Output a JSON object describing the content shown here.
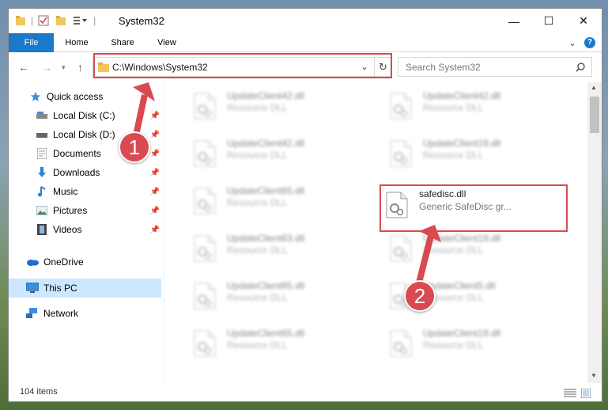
{
  "window": {
    "title": "System32",
    "controls": {
      "minimize": "—",
      "maximize": "☐",
      "close": "✕"
    }
  },
  "ribbon": {
    "tabs": [
      "File",
      "Home",
      "Share",
      "View"
    ],
    "help": "?"
  },
  "nav": {
    "address": "C:\\Windows\\System32",
    "search_placeholder": "Search System32"
  },
  "sidebar": {
    "items": [
      {
        "label": "Quick access",
        "icon": "star-icon",
        "pinned": false
      },
      {
        "label": "Local Disk (C:)",
        "icon": "drive-icon",
        "pinned": true
      },
      {
        "label": "Local Disk (D:)",
        "icon": "drive-icon",
        "pinned": true
      },
      {
        "label": "Documents",
        "icon": "documents-icon",
        "pinned": true
      },
      {
        "label": "Downloads",
        "icon": "download-icon",
        "pinned": true
      },
      {
        "label": "Music",
        "icon": "music-icon",
        "pinned": true
      },
      {
        "label": "Pictures",
        "icon": "pictures-icon",
        "pinned": true
      },
      {
        "label": "Videos",
        "icon": "videos-icon",
        "pinned": true
      },
      {
        "label": "OneDrive",
        "icon": "cloud-icon",
        "pinned": false
      },
      {
        "label": "This PC",
        "icon": "computer-icon",
        "pinned": false,
        "selected": true
      },
      {
        "label": "Network",
        "icon": "network-icon",
        "pinned": false
      }
    ]
  },
  "files": {
    "left": [
      {
        "name": "UpdateClient42.dll",
        "desc": "Resource DLL"
      },
      {
        "name": "UpdateClient42.dll",
        "desc": "Resource DLL"
      },
      {
        "name": "UpdateClient65.dll",
        "desc": "Resource DLL"
      },
      {
        "name": "UpdateClient63.dll",
        "desc": "Resource DLL"
      },
      {
        "name": "UpdateClient65.dll",
        "desc": "Resource DLL"
      },
      {
        "name": "UpdateClient65.dll",
        "desc": "Resource DLL"
      }
    ],
    "right": [
      {
        "name": "UpdateClient42.dll",
        "desc": "Resource DLL"
      },
      {
        "name": "UpdateClient19.dll",
        "desc": "Resource DLL"
      },
      {
        "name": "safedisc.dll",
        "desc": "Generic SafeDisc gr...",
        "highlighted": true
      },
      {
        "name": "UpdateClient19.dll",
        "desc": "Resource DLL"
      },
      {
        "name": "UpdateClient5.dll",
        "desc": "Resource DLL"
      },
      {
        "name": "UpdateClient19.dll",
        "desc": "Resource DLL"
      }
    ]
  },
  "status": {
    "count": "104 items"
  },
  "annotations": {
    "step1": "1",
    "step2": "2"
  },
  "colors": {
    "accent": "#1979ca",
    "highlight": "#d84a50",
    "selected": "#cce8ff"
  }
}
